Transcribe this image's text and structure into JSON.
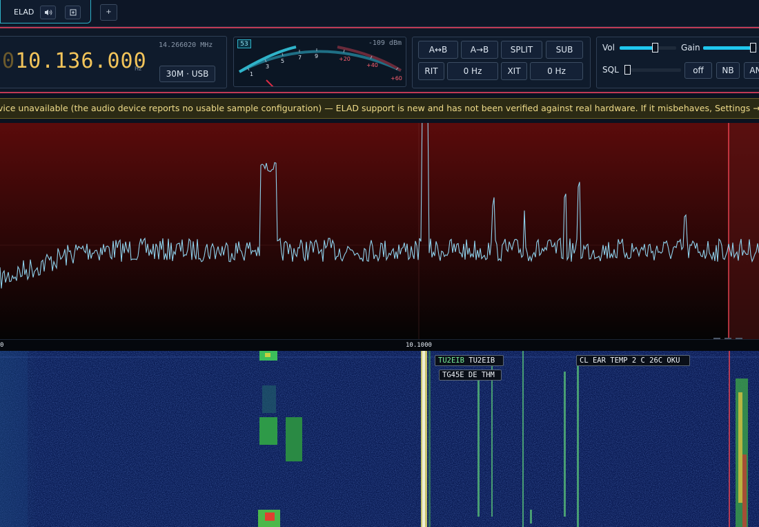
{
  "tabs": {
    "active_label": "ELAD",
    "audio_icon": "speaker-icon",
    "detach_icon": "detach-icon",
    "add_label": "+"
  },
  "frequency": {
    "prefix": "0",
    "main": "10.136.000",
    "unit": "Hz",
    "secondary": "14.266020 MHz",
    "band_mode": "30M · USB"
  },
  "smeter": {
    "s_value": "53",
    "dbm": "-109 dBm",
    "scale": [
      "1",
      "3",
      "5",
      "7",
      "9",
      "+20",
      "+40",
      "+60"
    ]
  },
  "vfo": {
    "swap": "A↔B",
    "copy": "A→B",
    "split": "SPLIT",
    "sub": "SUB",
    "rit": "RIT",
    "rit_value": "0 Hz",
    "xit": "XIT",
    "xit_value": "0 Hz"
  },
  "audio": {
    "vol_label": "Vol",
    "vol_level": 0.62,
    "gain_label": "Gain",
    "gain_level": 0.92,
    "sql_label": "SQL",
    "sql_level": 0.0,
    "off_label": "off",
    "nb_label": "NB",
    "an_label": "AN"
  },
  "banner": {
    "text": "vice unavailable (the audio device reports no usable sample configuration) — ELAD support is new and has not been verified against real hardware. If it misbehaves, Settings → Radio has a C"
  },
  "scale": {
    "left_label": "0",
    "center_label": "10.1000"
  },
  "spots": [
    {
      "call": "TU2EIB",
      "text": "TU2EIB"
    },
    {
      "call": "",
      "text": "TG45E DE THM"
    },
    {
      "call": "",
      "text": "CL EAR TEMP 2 C 26C OKU"
    }
  ],
  "colors": {
    "accent": "#1fc7ee",
    "frequency": "#f2c45a",
    "alert_border": "#c03a55",
    "trace": "#8fd3ee",
    "banner_text": "#f0dc8a"
  }
}
